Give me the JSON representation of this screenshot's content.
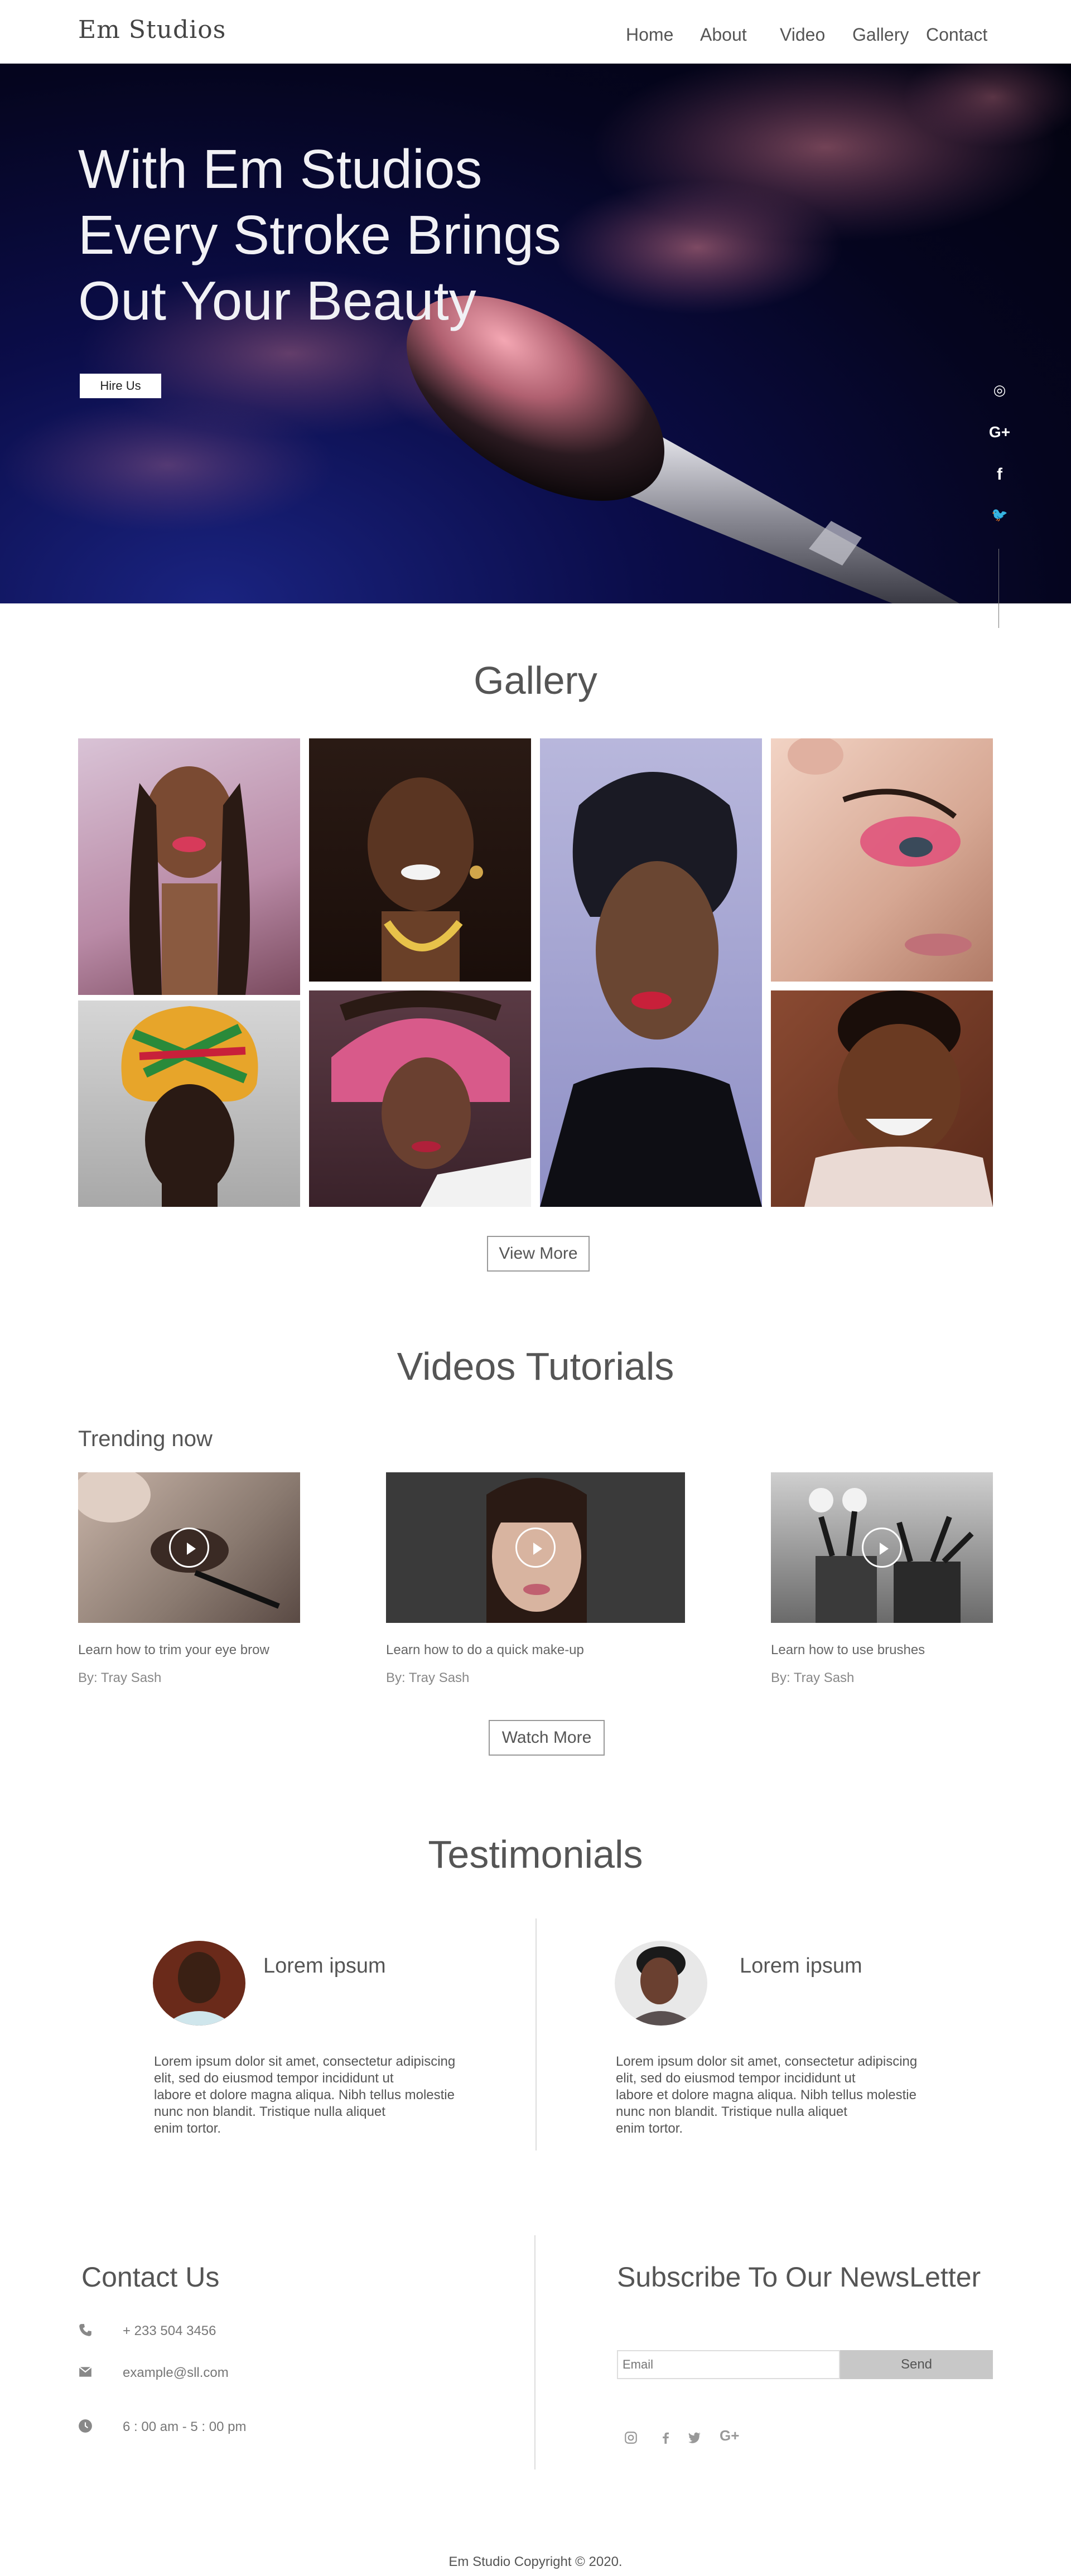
{
  "nav": {
    "logo": "Em Studios",
    "items": [
      {
        "label": "Home"
      },
      {
        "label": "About"
      },
      {
        "label": "Video"
      },
      {
        "label": "Gallery"
      },
      {
        "label": "Contact"
      }
    ]
  },
  "hero": {
    "title_lines": [
      "With Em Studios",
      "Every Stroke Brings",
      "Out Your Beauty"
    ],
    "cta_label": "Hire Us",
    "social_icons": [
      {
        "icon": "instagram-icon",
        "glyph": "◎"
      },
      {
        "icon": "google-plus-icon",
        "glyph": "G+"
      },
      {
        "icon": "facebook-icon",
        "glyph": "f"
      },
      {
        "icon": "twitter-icon",
        "glyph": "🐦"
      }
    ]
  },
  "gallery": {
    "title": "Gallery",
    "view_more_label": "View More"
  },
  "videos": {
    "title": "Videos Tutorials",
    "trending_label": "Trending now",
    "items": [
      {
        "title": "Learn how to trim your eye brow",
        "author": "By: Tray Sash"
      },
      {
        "title": "Learn how to do a quick make-up",
        "author": "By: Tray Sash"
      },
      {
        "title": "Learn how to use brushes",
        "author": "By: Tray Sash"
      }
    ],
    "watch_more_label": "Watch More"
  },
  "testimonials": {
    "title": "Testimonials",
    "items": [
      {
        "name": "Lorem ipsum",
        "lines": [
          "Lorem ipsum dolor sit amet, consectetur adipiscing",
          "elit, sed do eiusmod tempor incididunt ut",
          "labore et dolore magna aliqua. Nibh tellus molestie",
          "nunc non blandit. Tristique nulla aliquet",
          "enim tortor."
        ]
      },
      {
        "name": "Lorem ipsum",
        "lines": [
          "Lorem ipsum dolor sit amet, consectetur adipiscing",
          "elit, sed do eiusmod tempor incididunt ut",
          "labore et dolore magna aliqua. Nibh tellus molestie",
          "nunc non blandit. Tristique nulla aliquet",
          "enim tortor."
        ]
      }
    ]
  },
  "contact": {
    "title": "Contact Us",
    "phone": "+ 233 504 3456",
    "email": "example@sll.com",
    "hours": "6 : 00 am - 5 : 00 pm"
  },
  "newsletter": {
    "title": "Subscribe To Our NewsLetter",
    "email_placeholder": "Email",
    "send_label": "Send"
  },
  "footer": {
    "copyright": "Em Studio Copyright © 2020."
  }
}
